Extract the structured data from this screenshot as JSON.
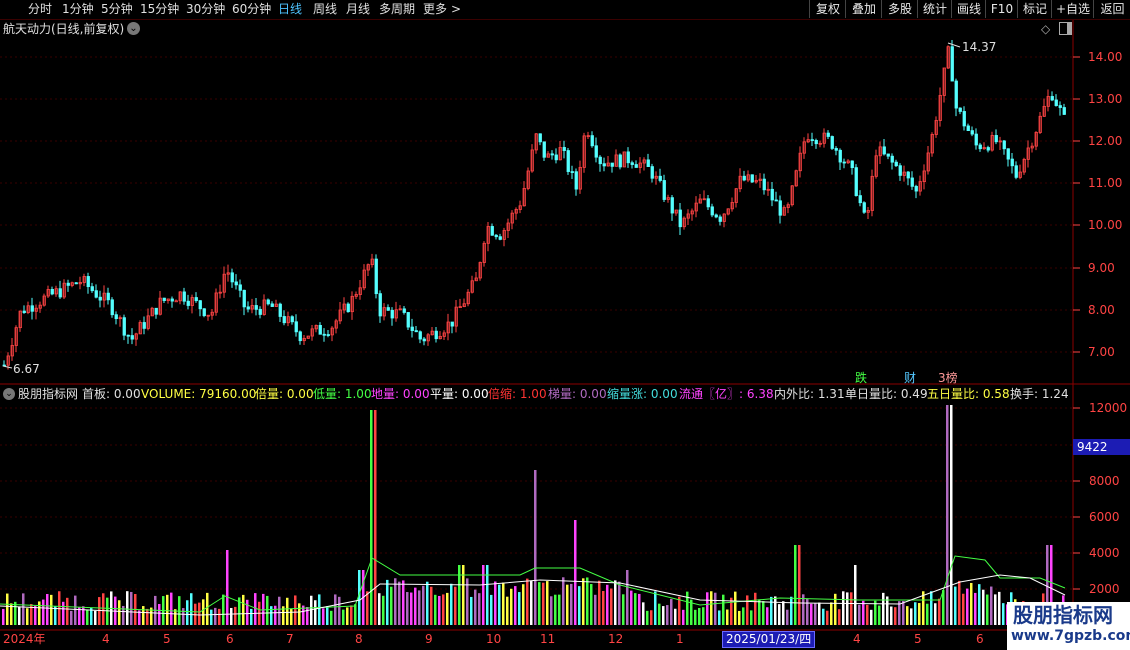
{
  "toolbar": {
    "periods": [
      "分时",
      "1分钟",
      "5分钟",
      "15分钟",
      "30分钟",
      "60分钟",
      "日线",
      "周线",
      "月线",
      "多周期",
      "更多"
    ],
    "more_arrow": ">",
    "actions": [
      "复权",
      "叠加",
      "多股",
      "统计",
      "画线",
      "F10",
      "标记",
      "+自选",
      "返回"
    ]
  },
  "main_chart": {
    "title": "航天动力(日线,前复权)",
    "dropdown_glyph": "⌄",
    "diamond_glyph": "◇",
    "high_label": "14.37",
    "low_label": "6.67",
    "price_ticks": [
      "14.00",
      "13.00",
      "12.00",
      "11.00",
      "10.00",
      "9.00",
      "8.00",
      "7.00"
    ],
    "markers": [
      "跌",
      "财",
      "3榜"
    ]
  },
  "indicator": {
    "name": "股朋指标网",
    "items": [
      {
        "label": "首板: 0.00",
        "color": "#e0e0e0"
      },
      {
        "label": "VOLUME: 79160.00",
        "color": "#ffff44"
      },
      {
        "label": "倍量: 0.00",
        "color": "#ffff44"
      },
      {
        "label": "低量: 1.00",
        "color": "#44ff44"
      },
      {
        "label": "地量: 0.00",
        "color": "#ff44ff"
      },
      {
        "label": "平量: 0.00",
        "color": "#ffffff"
      },
      {
        "label": "倍缩: 1.00",
        "color": "#ff3333"
      },
      {
        "label": "梯量: 0.00",
        "color": "#b06ac0"
      },
      {
        "label": "缩量涨: 0.00",
        "color": "#44dddd"
      },
      {
        "label": "流通〖亿〗: 6.38",
        "color": "#ff44ff"
      },
      {
        "label": "内外比: 1.31",
        "color": "#e0e0e0"
      },
      {
        "label": "单日量比: 0.49",
        "color": "#e0e0e0"
      },
      {
        "label": "五日量比: 0.58",
        "color": "#ffff44"
      },
      {
        "label": "换手: 1.24",
        "color": "#e0e0e0"
      }
    ],
    "volume_ticks": [
      "12000",
      "8000",
      "6000",
      "4000",
      "2000"
    ],
    "current_value": "9422"
  },
  "date_axis": {
    "year_label": "2024年",
    "months": [
      "4",
      "5",
      "6",
      "7",
      "8",
      "9",
      "10",
      "11",
      "12",
      "1",
      "4",
      "5",
      "6"
    ],
    "cursor_date": "2025/01/23/四"
  },
  "watermark": {
    "line1": "股朋指标网",
    "line2": "www.7gpzb.com"
  },
  "colors": {
    "up": "#ff4444",
    "down": "#54ffff",
    "grid": "#3a0000",
    "axis": "#8b0000"
  }
}
